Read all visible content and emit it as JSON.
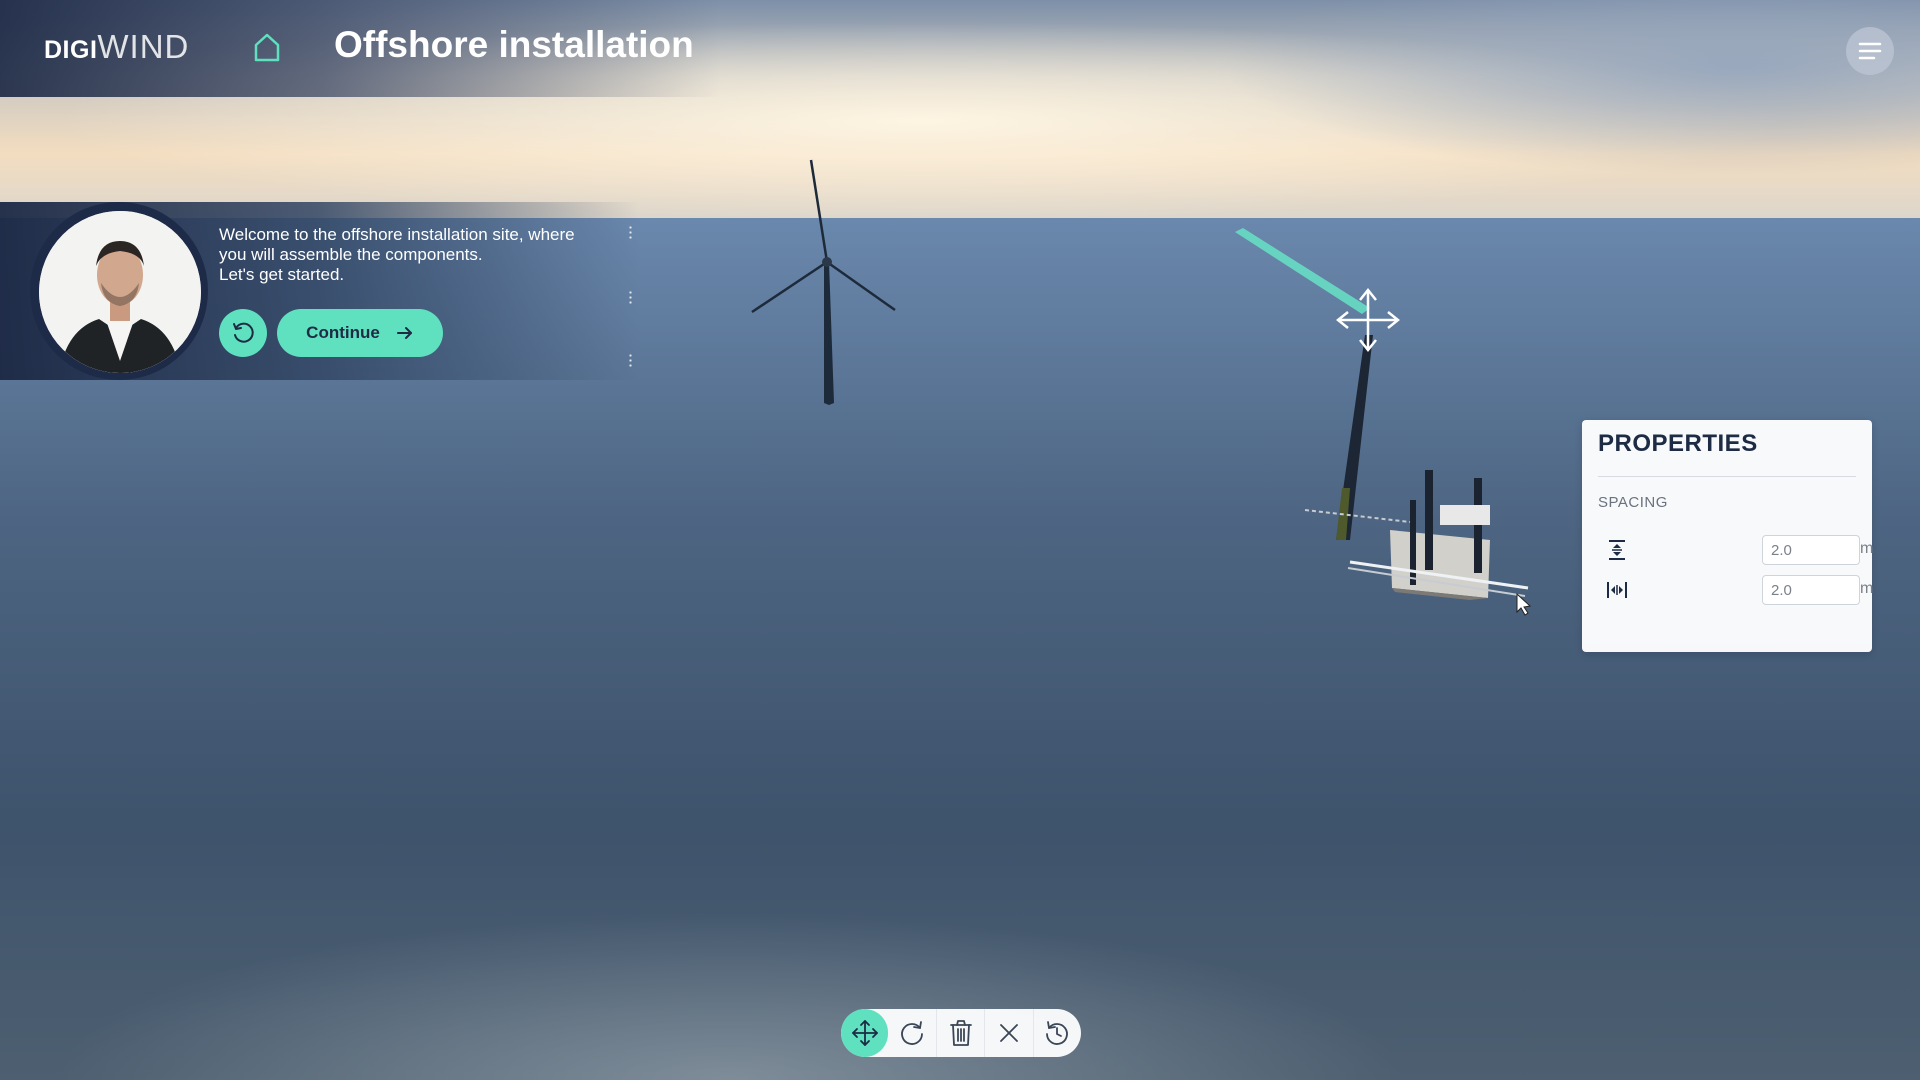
{
  "app": {
    "logo_part1": "DIGI",
    "logo_part2": "WIND",
    "title": "Offshore installation"
  },
  "header": {
    "home_icon": "home-icon",
    "menu_icon": "hamburger-menu-icon"
  },
  "guide": {
    "line1": "Welcome to the offshore installation site, where",
    "line2": "you will assemble the components.",
    "line3": "Let's get started.",
    "replay_icon": "replay-icon",
    "continue_label": "Continue",
    "continue_icon": "arrow-right-icon"
  },
  "properties": {
    "title": "PROPERTIES",
    "section": "SPACING",
    "vertical": {
      "icon": "vertical-spacing-icon",
      "value": "2.0",
      "unit": "m"
    },
    "horizontal": {
      "icon": "horizontal-spacing-icon",
      "value": "2.0",
      "unit": "m"
    }
  },
  "toolbar": {
    "tools": [
      "move-icon",
      "rotate-icon",
      "delete-icon",
      "close-icon",
      "reset-icon"
    ],
    "active": "move-icon"
  },
  "colors": {
    "accent": "#5fe0bf",
    "navy": "#1d2b44",
    "panel": "#ffffff"
  }
}
